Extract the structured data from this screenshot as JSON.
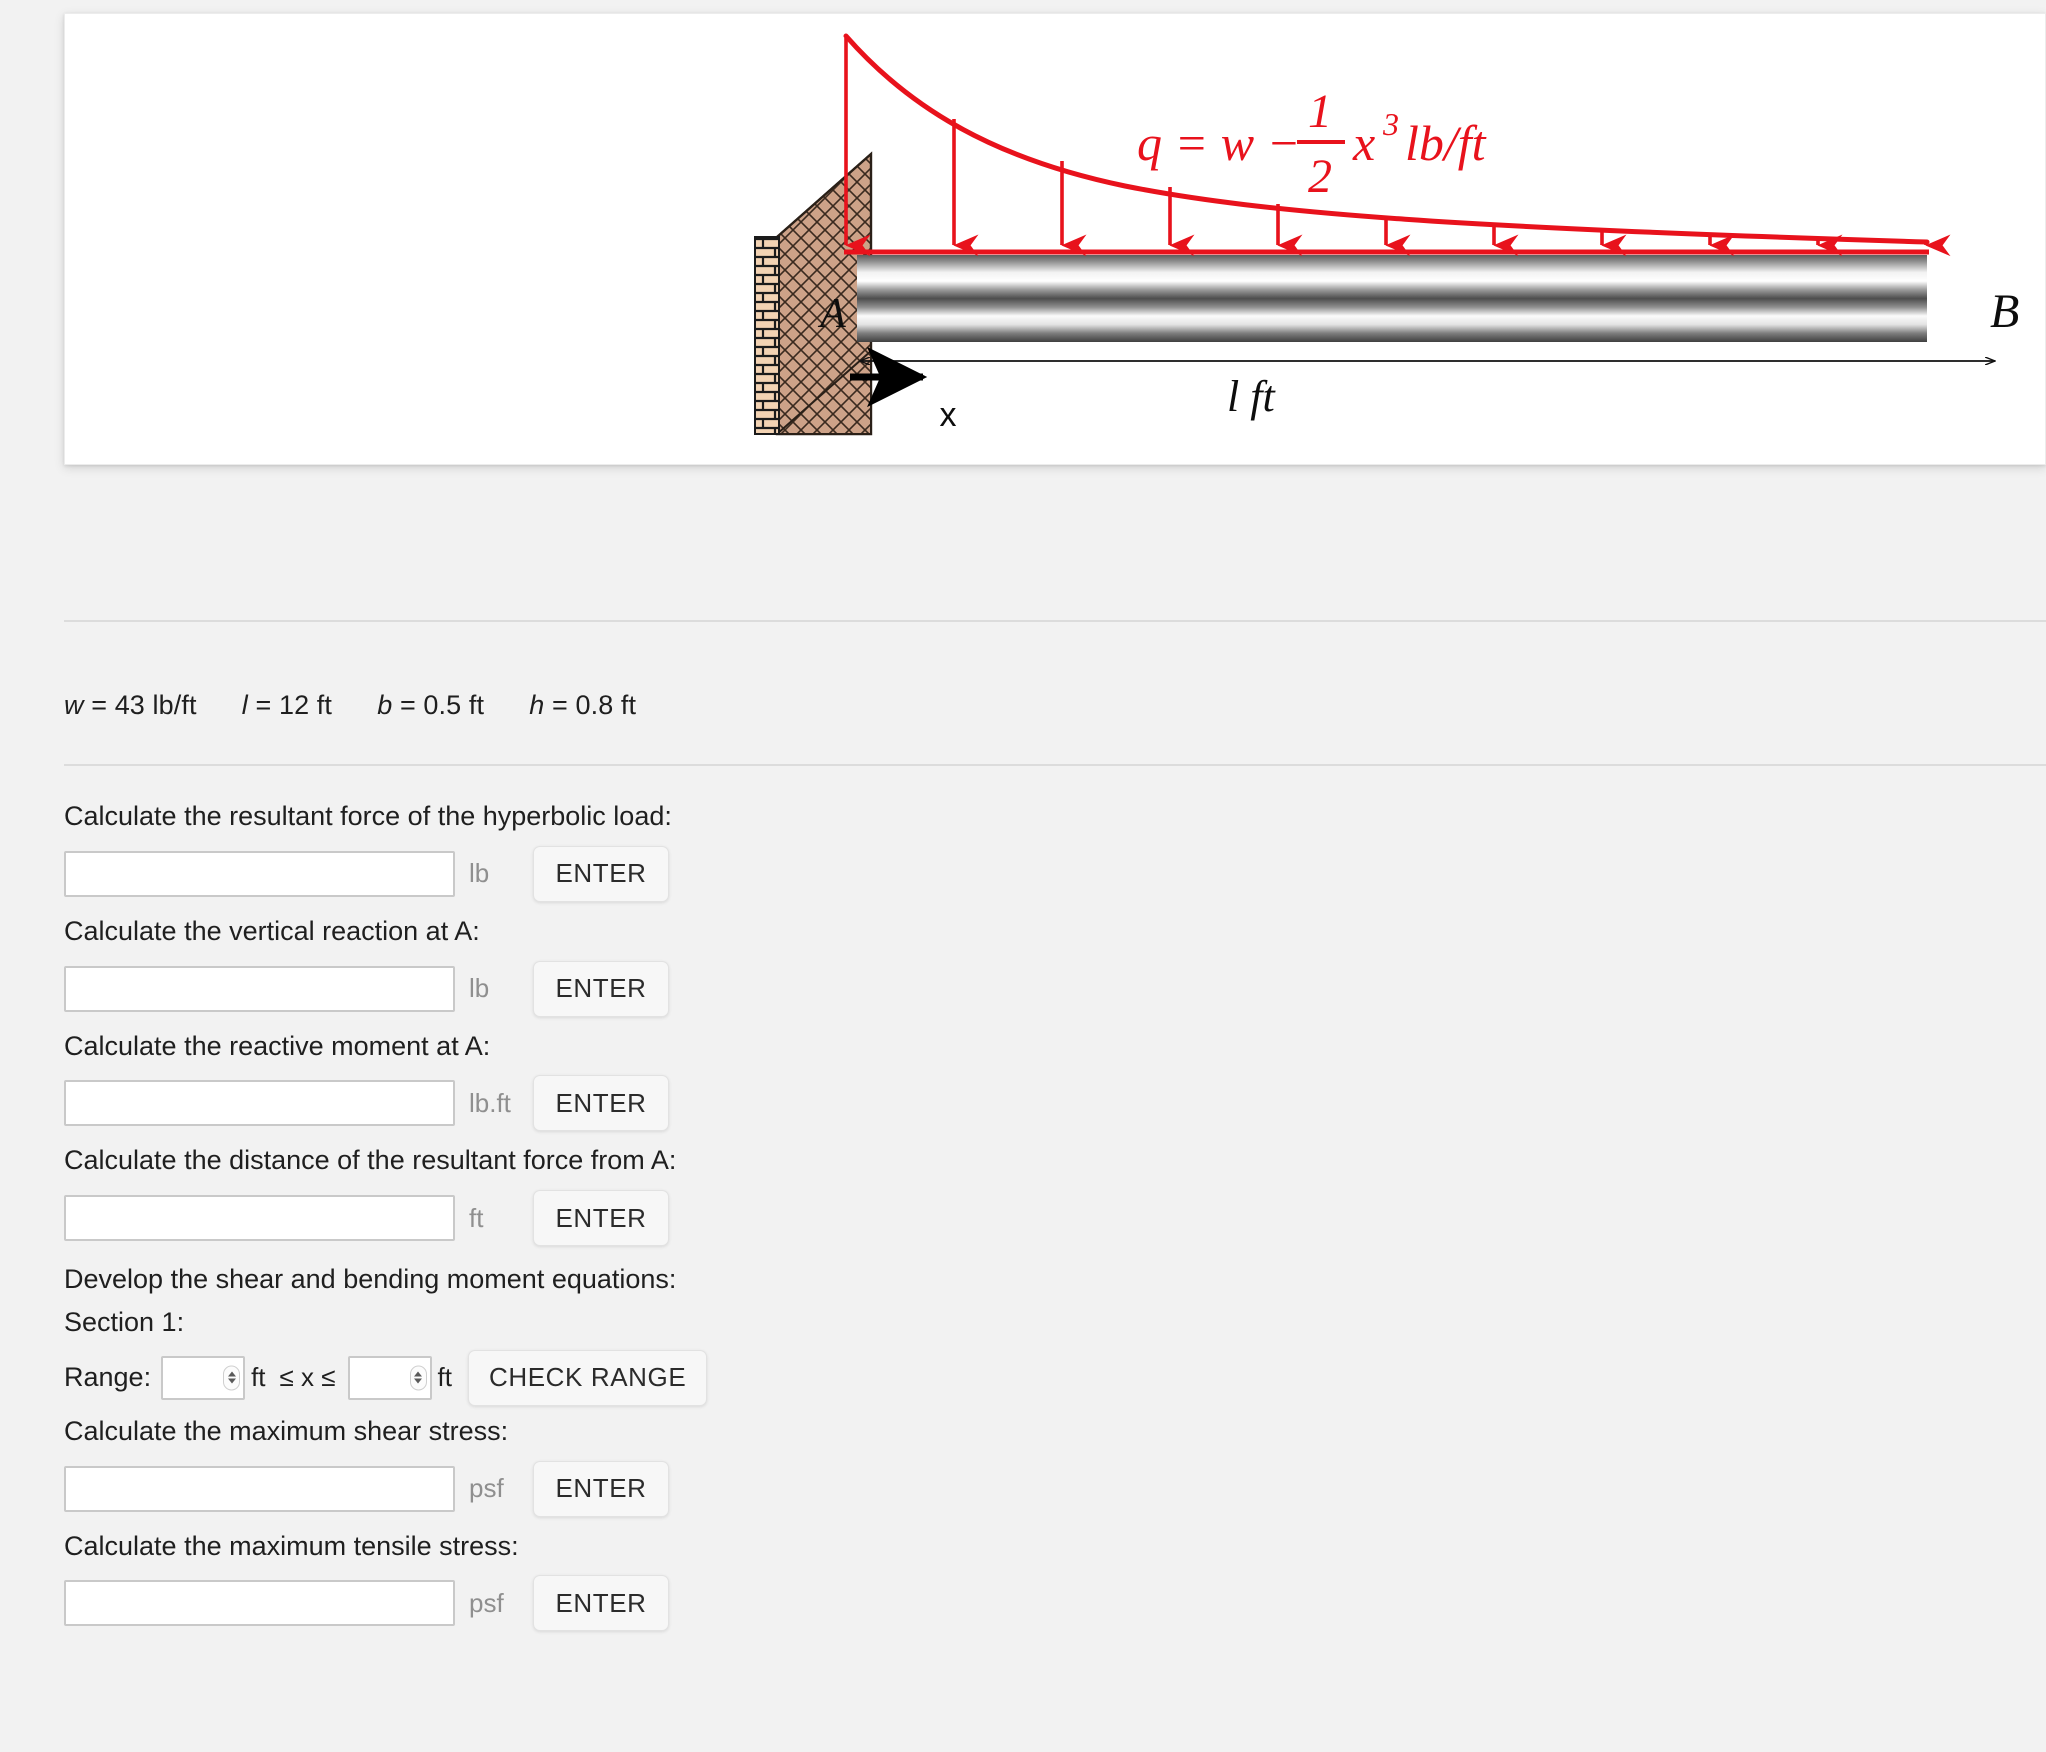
{
  "figure": {
    "load_equation": "q = w − (1/2)x³ lb/ft",
    "load_eq_parts": {
      "lhs": "q = w −",
      "frac_num": "1",
      "frac_den": "2",
      "rhs_base": "x",
      "rhs_exp": "3",
      "units": "lb/ft"
    },
    "support_label": "A",
    "free_end_label": "B",
    "x_axis_label": "x",
    "length_label": "l ft",
    "load_color": "#e8121c",
    "wall_color": "#d9a985",
    "beam_dark": "#4a4a4a",
    "arrow_count": 11
  },
  "params": {
    "w_sym": "w",
    "w_val": "= 43 lb/ft",
    "l_sym": "l",
    "l_val": "= 12 ft",
    "b_sym": "b",
    "b_val": "= 0.5 ft",
    "h_sym": "h",
    "h_val": "= 0.8 ft"
  },
  "questions": [
    {
      "label": "Calculate the resultant force of the hyperbolic load:",
      "value": "",
      "unit": "lb",
      "button": "ENTER"
    },
    {
      "label": "Calculate the vertical reaction at A:",
      "value": "",
      "unit": "lb",
      "button": "ENTER"
    },
    {
      "label": "Calculate the reactive moment at A:",
      "value": "",
      "unit": "lb.ft",
      "button": "ENTER"
    },
    {
      "label": "Calculate the distance of the resultant force from A:",
      "value": "",
      "unit": "ft",
      "button": "ENTER"
    }
  ],
  "develop": {
    "heading": "Develop the shear and bending moment equations:",
    "section_title": "Section 1:",
    "range_label": "Range:",
    "range_min": "",
    "range_max": "",
    "range_unit_left": "ft",
    "range_unit_right": "ft",
    "inequality": "≤ x ≤",
    "check_button": "CHECK RANGE"
  },
  "stress_questions": [
    {
      "label": "Calculate the maximum shear stress:",
      "value": "",
      "unit": "psf",
      "button": "ENTER"
    },
    {
      "label": "Calculate the maximum tensile stress:",
      "value": "",
      "unit": "psf",
      "button": "ENTER"
    }
  ]
}
